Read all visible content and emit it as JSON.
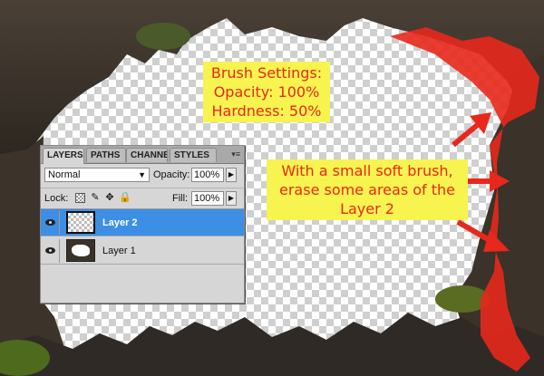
{
  "annotations": {
    "brush_settings": [
      "Brush Settings:",
      "Opacity: 100%",
      "Hardness: 50%"
    ],
    "instruction": [
      "With a small soft brush,",
      "erase some areas of the",
      "Layer 2"
    ],
    "text_color": "#e8281c",
    "background_color": "#f7f44f",
    "arrow_color": "#e8281c",
    "highlight_color": "#e8281c"
  },
  "panel": {
    "tabs": [
      "LAYERS",
      "PATHS",
      "CHANNE",
      "STYLES"
    ],
    "menu_icon": "▾≡",
    "blend_mode": "Normal",
    "opacity_label": "Opacity:",
    "opacity_value": "100%",
    "lock_label": "Lock:",
    "fill_label": "Fill:",
    "fill_value": "100%",
    "layers": [
      {
        "name": "Layer 2",
        "selected": true
      },
      {
        "name": "Layer 1",
        "selected": false
      }
    ],
    "selection_color": "#3d8ee5"
  }
}
